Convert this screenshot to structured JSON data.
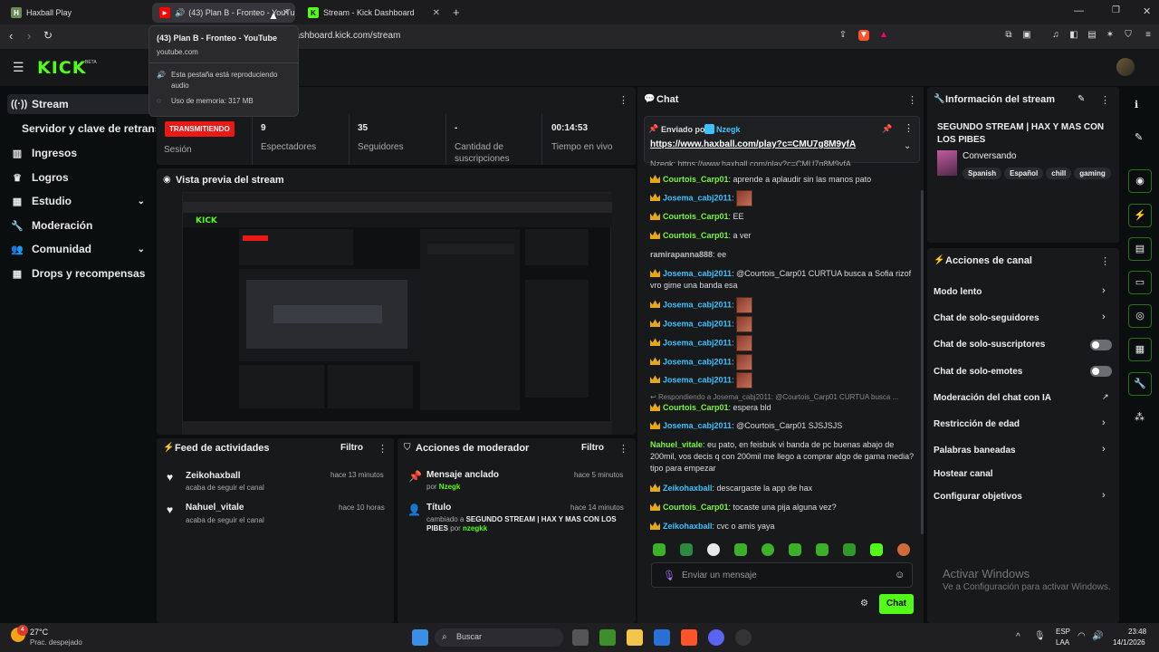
{
  "browser": {
    "tabs": [
      {
        "label": "Haxball Play"
      },
      {
        "label": "(43) Plan B - Fronteo - YouTube"
      },
      {
        "label": "Stream - Kick Dashboard"
      }
    ],
    "url": "dashboard.kick.com/stream",
    "tooltip": {
      "title": "(43) Plan B - Fronteo - YouTube",
      "domain": "youtube.com",
      "audio": "Esta pestaña está reproduciendo audio",
      "memory": "Uso de memoria: 317 MB"
    }
  },
  "header": {
    "logo": "KICK",
    "beta": "BETA"
  },
  "sidebar": {
    "items": [
      {
        "label": "Stream",
        "icon": "broadcast-icon"
      },
      {
        "label": "Servidor y clave de retransm"
      },
      {
        "label": "Ingresos",
        "icon": "chart-icon"
      },
      {
        "label": "Logros",
        "icon": "trophy-icon"
      },
      {
        "label": "Estudio",
        "icon": "grid-icon"
      },
      {
        "label": "Moderación",
        "icon": "wrench-icon"
      },
      {
        "label": "Comunidad",
        "icon": "people-icon"
      },
      {
        "label": "Drops y recompensas",
        "icon": "gift-icon"
      }
    ]
  },
  "session": {
    "badge": "TRANSMITIENDO",
    "session_label": "Sesión",
    "stats": [
      {
        "value": "9",
        "label": "Espectadores"
      },
      {
        "value": "35",
        "label": "Seguidores"
      },
      {
        "value": "-",
        "label": "Cantidad de suscripciones"
      },
      {
        "value": "00:14:53",
        "label": "Tiempo en vivo"
      }
    ]
  },
  "preview": {
    "title": "Vista previa del stream"
  },
  "feed": {
    "title": "Feed de actividades",
    "filter": "Filtro",
    "items": [
      {
        "name": "Zeikohaxball",
        "sub": "acaba de seguir el canal",
        "time": "hace 13 minutos"
      },
      {
        "name": "Nahuel_vitale",
        "sub": "acaba de seguir el canal",
        "time": "hace 10 horas"
      }
    ]
  },
  "modactions": {
    "title": "Acciones de moderador",
    "filter": "Filtro",
    "items": [
      {
        "name": "Mensaje anclado",
        "sub": "por",
        "user": "Nzegk",
        "time": "hace 5 minutos"
      },
      {
        "name": "Título",
        "sub": "cambiado a",
        "bold": "SEGUNDO STREAM | HAX Y MAS CON LOS PIBES",
        "by": "por",
        "user": "nzegkk",
        "time": "hace 14 minutos"
      }
    ]
  },
  "chat": {
    "title": "Chat",
    "pinned": {
      "by": "Enviado por",
      "user": "Nzegk",
      "link": "https://www.haxball.com/play?c=CMU7g8M9yfA"
    },
    "cutoff": "Nzegk: https://www.haxball.com/play?c=CMU7g8M9yfA",
    "messages": [
      {
        "user": "Courtois_Carp01",
        "text": "aprende a aplaudir sin las manos pato"
      },
      {
        "user": "Josema_cabj2011",
        "text": ""
      },
      {
        "user": "Courtois_Carp01",
        "text": "EE"
      },
      {
        "user": "Courtois_Carp01",
        "text": "a ver"
      },
      {
        "user": "ramirapanna888",
        "text": "ee"
      },
      {
        "user": "Josema_cabj2011",
        "text": "@Courtois_Carp01 CURTUA busca a Sofia rizof vro gime una banda esa"
      },
      {
        "user": "Josema_cabj2011",
        "text": ""
      },
      {
        "user": "Josema_cabj2011",
        "text": ""
      },
      {
        "user": "Josema_cabj2011",
        "text": ""
      },
      {
        "user": "Josema_cabj2011",
        "text": ""
      },
      {
        "user": "Josema_cabj2011",
        "text": ""
      },
      {
        "reply": "Respondiendo a Josema_cabj2011: @Courtois_Carp01 CURTUA busca ..."
      },
      {
        "user": "Courtois_Carp01",
        "text": "espera bld"
      },
      {
        "user": "Josema_cabj2011",
        "text": "@Courtois_Carp01 SJSJSJS"
      },
      {
        "user": "Nahuel_vitale",
        "text": "eu pato, en feisbuk vi banda de pc buenas abajo de 200mil, vos decis q con 200mil me llego a comprar algo de gama media? tipo para empezar"
      },
      {
        "user": "Zeikohaxball",
        "text": "descargaste la app de hax"
      },
      {
        "user": "Courtois_Carp01",
        "text": "tocaste una pija alguna vez?"
      },
      {
        "user": "Zeikohaxball",
        "text": "cvc o amis yaya"
      }
    ],
    "input_placeholder": "Enviar un mensaje",
    "send": "Chat"
  },
  "streaminfo": {
    "title": "Información del stream",
    "stream_title": "SEGUNDO STREAM | HAX Y MAS CON LOS PIBES",
    "category": "Conversando",
    "tags": [
      "Spanish",
      "Español",
      "chill",
      "gaming"
    ]
  },
  "channel": {
    "title": "Acciones de canal",
    "items": [
      {
        "label": "Modo lento",
        "control": "chevron"
      },
      {
        "label": "Chat de solo-seguidores",
        "control": "chevron"
      },
      {
        "label": "Chat de solo-suscriptores",
        "control": "toggle"
      },
      {
        "label": "Chat de solo-emotes",
        "control": "toggle"
      },
      {
        "label": "Moderación del chat con IA",
        "control": "external"
      },
      {
        "label": "Restricción de edad",
        "control": "chevron"
      },
      {
        "label": "Palabras baneadas",
        "control": "chevron"
      },
      {
        "label": "Hostear canal",
        "control": "none"
      },
      {
        "label": "Configurar objetivos",
        "control": "chevron"
      }
    ]
  },
  "watermark": {
    "line1": "Activar Windows",
    "line2": "Ve a Configuración para activar Windows."
  },
  "taskbar": {
    "temp": "27°C",
    "weather": "Prac. despejado",
    "badge": "4",
    "search": "Buscar",
    "lang1": "ESP",
    "lang2": "LAA",
    "time": "23:48",
    "date": "14/1/2026"
  },
  "colors": {
    "kick_green": "#53fc18",
    "live_red": "#e91916",
    "bg": "#0b0e0f",
    "panel": "#18191b"
  }
}
